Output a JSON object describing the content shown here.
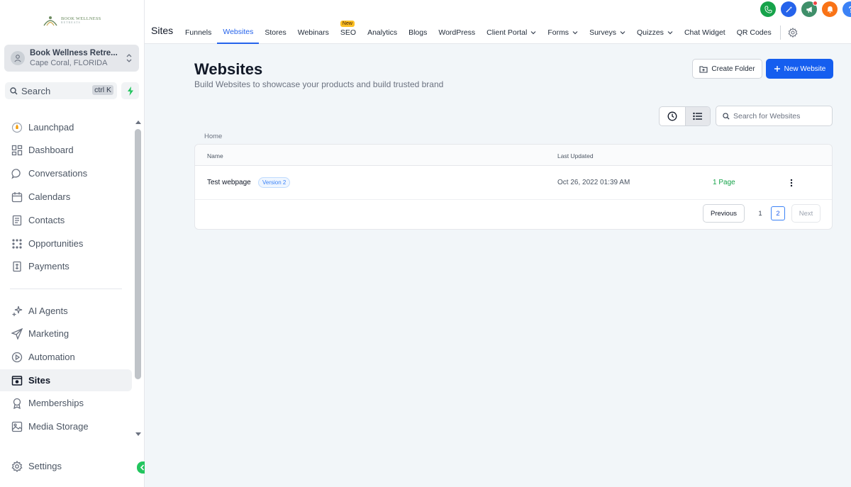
{
  "brand": {
    "logo_line1": "BOOK WELLNESS",
    "logo_line2": "RETREATS"
  },
  "account": {
    "name": "Book Wellness Retre...",
    "location": "Cape Coral, FLORIDA"
  },
  "sidebar_search": {
    "label": "Search",
    "shortcut": "ctrl K"
  },
  "sidebar": {
    "items": [
      {
        "label": "Launchpad",
        "icon": "rocket-icon"
      },
      {
        "label": "Dashboard",
        "icon": "dashboard-icon"
      },
      {
        "label": "Conversations",
        "icon": "chat-icon"
      },
      {
        "label": "Calendars",
        "icon": "calendar-icon"
      },
      {
        "label": "Contacts",
        "icon": "contacts-icon"
      },
      {
        "label": "Opportunities",
        "icon": "opportunities-icon"
      },
      {
        "label": "Payments",
        "icon": "payments-icon"
      },
      {
        "label": "AI Agents",
        "icon": "sparkle-icon"
      },
      {
        "label": "Marketing",
        "icon": "send-icon"
      },
      {
        "label": "Automation",
        "icon": "automation-icon"
      },
      {
        "label": "Sites",
        "icon": "sites-icon",
        "active": true
      },
      {
        "label": "Memberships",
        "icon": "badge-icon"
      },
      {
        "label": "Media Storage",
        "icon": "image-icon"
      },
      {
        "label": "Settings",
        "icon": "gear-icon"
      }
    ]
  },
  "header": {
    "section_title": "Sites",
    "tabs": [
      {
        "label": "Funnels"
      },
      {
        "label": "Websites",
        "active": true
      },
      {
        "label": "Stores"
      },
      {
        "label": "Webinars"
      },
      {
        "label": "SEO",
        "badge": "New"
      },
      {
        "label": "Analytics"
      },
      {
        "label": "Blogs"
      },
      {
        "label": "WordPress"
      },
      {
        "label": "Client Portal",
        "dropdown": true
      },
      {
        "label": "Forms",
        "dropdown": true
      },
      {
        "label": "Surveys",
        "dropdown": true
      },
      {
        "label": "Quizzes",
        "dropdown": true
      },
      {
        "label": "Chat Widget"
      },
      {
        "label": "QR Codes"
      }
    ],
    "top_icons": [
      {
        "name": "phone-icon",
        "color": "#16a34a"
      },
      {
        "name": "magic-wand-icon",
        "color": "#2563eb"
      },
      {
        "name": "megaphone-icon",
        "color": "#3f8f6a"
      },
      {
        "name": "bell-icon",
        "color": "#f97316"
      },
      {
        "name": "help-icon",
        "color": "#3b82f6"
      }
    ]
  },
  "page": {
    "title": "Websites",
    "subtitle": "Build Websites to showcase your products and build trusted brand",
    "create_folder_label": "Create Folder",
    "new_website_label": "New Website",
    "search_placeholder": "Search for Websites",
    "breadcrumb": "Home"
  },
  "table": {
    "columns": {
      "name": "Name",
      "last_updated": "Last Updated"
    },
    "rows": [
      {
        "name": "Test webpage",
        "version": "Version 2",
        "last_updated": "Oct 26, 2022 01:39 AM",
        "pages": "1 Page"
      }
    ]
  },
  "pagination": {
    "previous": "Previous",
    "pages": [
      "1",
      "2"
    ],
    "current": "2",
    "next": "Next"
  },
  "colors": {
    "primary": "#155eef",
    "accent_green": "#16a34a",
    "sidebar_active_bg": "#f0f2f4"
  }
}
